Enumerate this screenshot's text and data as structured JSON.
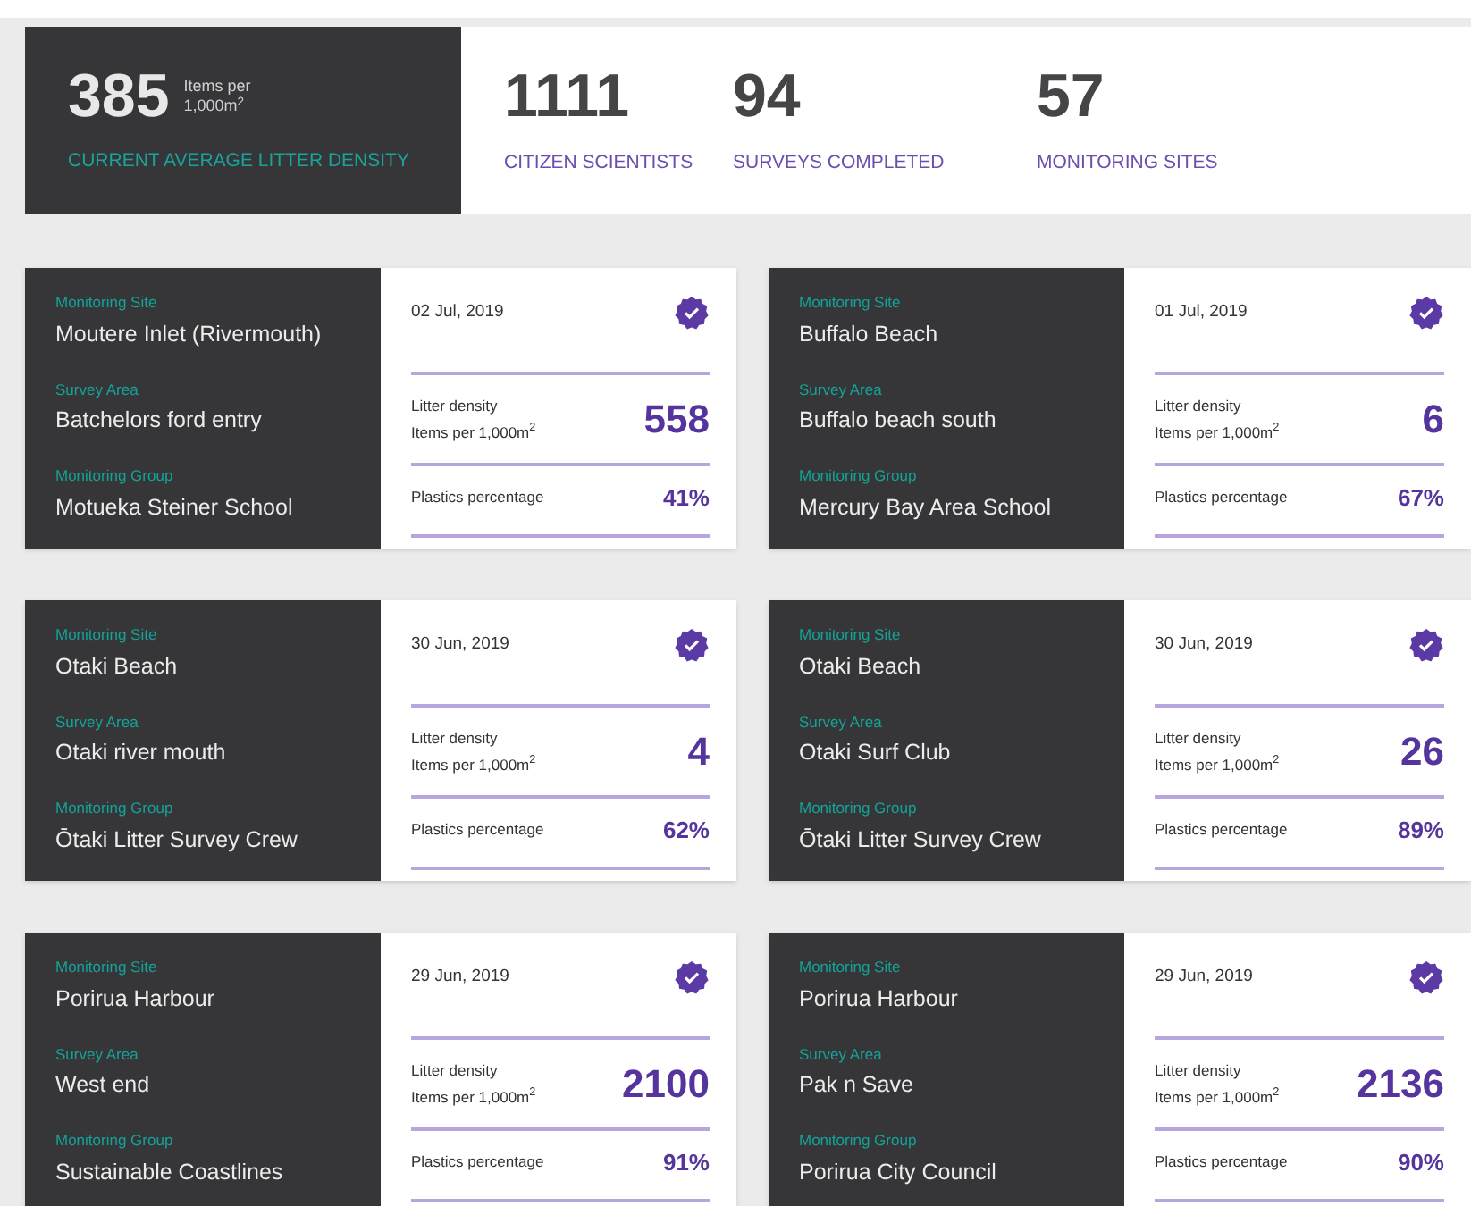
{
  "summary": {
    "highlight": {
      "value": "385",
      "unit": "Items per 1,000m$^{2}$",
      "label": "CURRENT AVERAGE LITTER DENSITY"
    },
    "stats": [
      {
        "value": "1111",
        "label": "CITIZEN SCIENTISTS"
      },
      {
        "value": "94",
        "label": "SURVEYS COMPLETED"
      },
      {
        "value": "57",
        "label": "MONITORING SITES"
      }
    ]
  },
  "surveys": [
    {
      "site_label": "Monitoring Site",
      "site": "Moutere Inlet (Rivermouth)",
      "area_label": "Survey Area",
      "area": "Batchelors ford entry",
      "group_label": "Monitoring Group",
      "group": "Motueka Steiner School",
      "date": "02 Jul, 2019",
      "density_label": "Litter density",
      "density_unit": "Items per 1,000m$^{2}$",
      "density": "558",
      "plastics_label": "Plastics percentage",
      "plastics": "41%"
    },
    {
      "site_label": "Monitoring Site",
      "site": "Buffalo Beach",
      "area_label": "Survey Area",
      "area": "Buffalo beach south",
      "group_label": "Monitoring Group",
      "group": "Mercury Bay Area School",
      "date": "01 Jul, 2019",
      "density_label": "Litter density",
      "density_unit": "Items per 1,000m$^{2}$",
      "density": "6",
      "plastics_label": "Plastics percentage",
      "plastics": "67%"
    },
    {
      "site_label": "Monitoring Site",
      "site": "Otaki Beach",
      "area_label": "Survey Area",
      "area": "Otaki river mouth",
      "group_label": "Monitoring Group",
      "group": "Ōtaki Litter Survey Crew",
      "date": "30 Jun, 2019",
      "density_label": "Litter density",
      "density_unit": "Items per 1,000m$^{2}$",
      "density": "4",
      "plastics_label": "Plastics percentage",
      "plastics": "62%"
    },
    {
      "site_label": "Monitoring Site",
      "site": "Otaki Beach",
      "area_label": "Survey Area",
      "area": "Otaki Surf Club",
      "group_label": "Monitoring Group",
      "group": "Ōtaki Litter Survey Crew",
      "date": "30 Jun, 2019",
      "density_label": "Litter density",
      "density_unit": "Items per 1,000m$^{2}$",
      "density": "26",
      "plastics_label": "Plastics percentage",
      "plastics": "89%"
    },
    {
      "site_label": "Monitoring Site",
      "site": "Porirua Harbour",
      "area_label": "Survey Area",
      "area": "West end",
      "group_label": "Monitoring Group",
      "group": "Sustainable Coastlines",
      "date": "29 Jun, 2019",
      "density_label": "Litter density",
      "density_unit": "Items per 1,000m$^{2}$",
      "density": "2100",
      "plastics_label": "Plastics percentage",
      "plastics": "91%"
    },
    {
      "site_label": "Monitoring Site",
      "site": "Porirua Harbour",
      "area_label": "Survey Area",
      "area": "Pak n Save",
      "group_label": "Monitoring Group",
      "group": "Porirua City Council",
      "date": "29 Jun, 2019",
      "density_label": "Litter density",
      "density_unit": "Items per 1,000m$^{2}$",
      "density": "2136",
      "plastics_label": "Plastics percentage",
      "plastics": "90%"
    }
  ]
}
